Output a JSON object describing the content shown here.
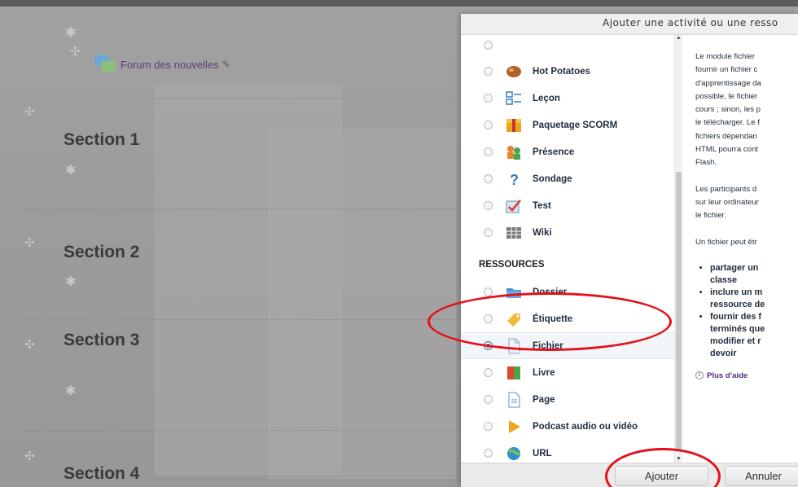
{
  "course": {
    "forum_link": "Forum des nouvelles",
    "sections": [
      "Section 1",
      "Section 2",
      "Section 3",
      "Section 4"
    ]
  },
  "modal": {
    "title": "Ajouter une activité ou une resso",
    "activities": [
      {
        "label": "Hot Potatoes",
        "icon": "hot-potatoes-icon"
      },
      {
        "label": "Leçon",
        "icon": "lesson-icon"
      },
      {
        "label": "Paquetage SCORM",
        "icon": "scorm-package-icon"
      },
      {
        "label": "Présence",
        "icon": "attendance-icon"
      },
      {
        "label": "Sondage",
        "icon": "question-mark-icon"
      },
      {
        "label": "Test",
        "icon": "quiz-check-icon"
      },
      {
        "label": "Wiki",
        "icon": "wiki-icon"
      }
    ],
    "resources_header": "RESSOURCES",
    "resources": [
      {
        "label": "Dossier",
        "icon": "folder-icon"
      },
      {
        "label": "Étiquette",
        "icon": "label-tag-icon"
      },
      {
        "label": "Fichier",
        "icon": "file-icon",
        "selected": true
      },
      {
        "label": "Livre",
        "icon": "book-icon"
      },
      {
        "label": "Page",
        "icon": "page-icon"
      },
      {
        "label": "Podcast audio ou vidéo",
        "icon": "podcast-play-icon"
      },
      {
        "label": "URL",
        "icon": "url-globe-icon"
      }
    ],
    "help": {
      "para1": [
        "Le module fichier",
        "fournir un fichier c",
        "d'apprentissage da",
        "possible, le fichier",
        "cours ; sinon, les p",
        "le télécharger. Le f",
        "fichiers dépendan",
        "HTML pourra cont",
        "Flash."
      ],
      "para2": [
        "Les participants d",
        "sur leur ordinateur",
        "le fichier."
      ],
      "para3": [
        "Un fichier peut êtr"
      ],
      "bullets": [
        [
          "partager un",
          "classe"
        ],
        [
          "inclure un m",
          "ressource de"
        ],
        [
          "fournir des f",
          "terminés que",
          "modifier et r",
          "devoir"
        ]
      ],
      "more_help": "Plus d'aide"
    },
    "add_button": "Ajouter",
    "cancel_button": "Annuler"
  },
  "colors": {
    "annotation": "#e4101a",
    "link": "#4b2f86"
  }
}
